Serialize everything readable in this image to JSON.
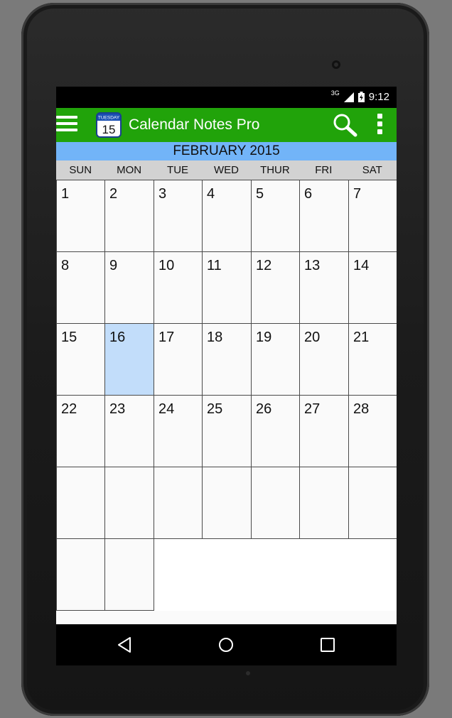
{
  "status_bar": {
    "network": "3G",
    "time": "9:12"
  },
  "app_bar": {
    "title": "Calendar Notes Pro",
    "logo": {
      "day_label": "TUESDAY",
      "number": "15"
    },
    "icons": {
      "menu": "menu-icon",
      "search": "search-icon",
      "more": "more-vert-icon"
    }
  },
  "calendar": {
    "month_label": "FEBRUARY 2015",
    "weekdays": [
      "SUN",
      "MON",
      "TUE",
      "WED",
      "THUR",
      "FRI",
      "SAT"
    ],
    "days": [
      [
        "1",
        "2",
        "3",
        "4",
        "5",
        "6",
        "7"
      ],
      [
        "8",
        "9",
        "10",
        "11",
        "12",
        "13",
        "14"
      ],
      [
        "15",
        "16",
        "17",
        "18",
        "19",
        "20",
        "21"
      ],
      [
        "22",
        "23",
        "24",
        "25",
        "26",
        "27",
        "28"
      ],
      [
        "",
        "",
        "",
        "",
        "",
        "",
        ""
      ],
      [
        "",
        ""
      ]
    ],
    "selected_day": "16"
  },
  "colors": {
    "app_bar": "#21a30a",
    "month_bar": "#72b4f8",
    "weekday_bar": "#d2d2d2",
    "selected_cell": "#c2ddfa"
  },
  "nav_bar": {
    "icons": [
      "back-icon",
      "home-icon",
      "recents-icon"
    ]
  }
}
